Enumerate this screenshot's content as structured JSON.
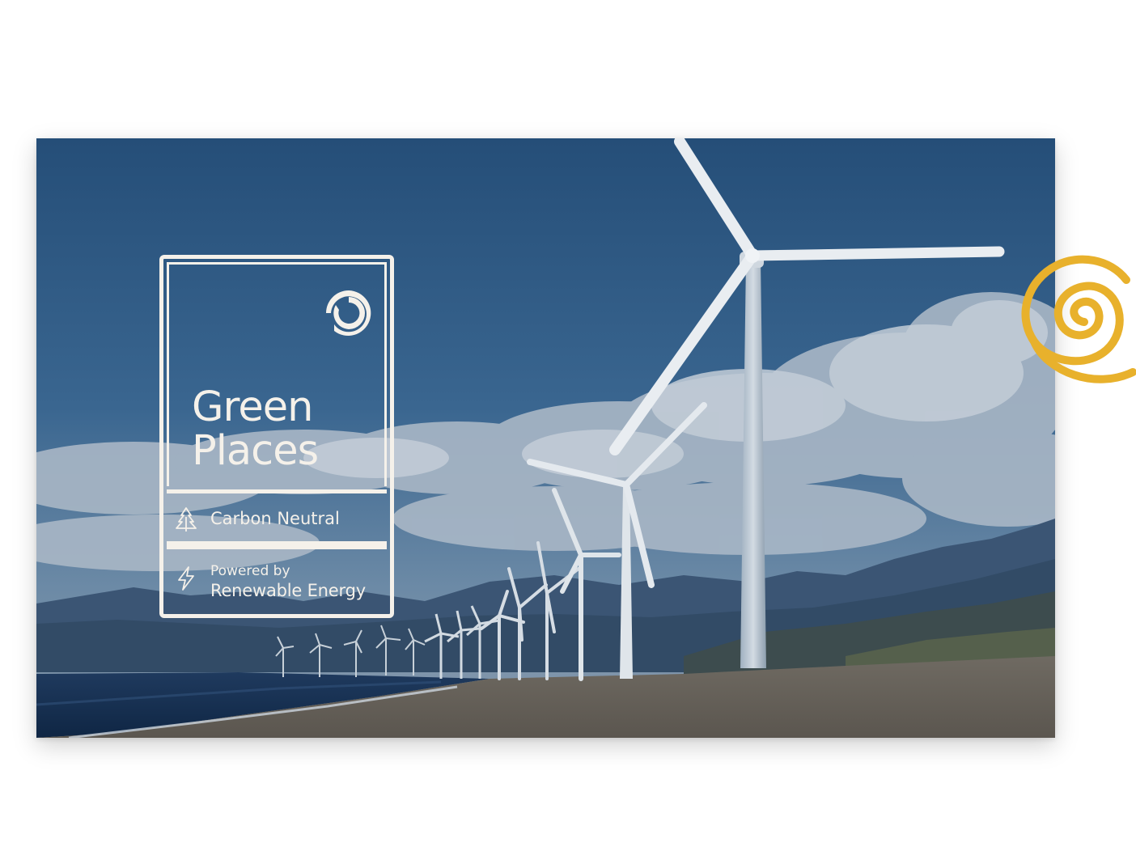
{
  "badge": {
    "title": "Green\nPlaces",
    "carbon_label": "Carbon Neutral",
    "energy_prefix": "Powered by",
    "energy_label": "Renewable Energy",
    "icons": {
      "logo": "green-places-logo",
      "carbon": "tree-icon",
      "energy": "lightning-bolt-icon"
    }
  },
  "decoration": {
    "spiral_color": "#e8b12c"
  },
  "colors": {
    "badge_fg": "#f5f1ea",
    "sky_top": "#26507a",
    "sky_bottom": "#6f8fac"
  }
}
